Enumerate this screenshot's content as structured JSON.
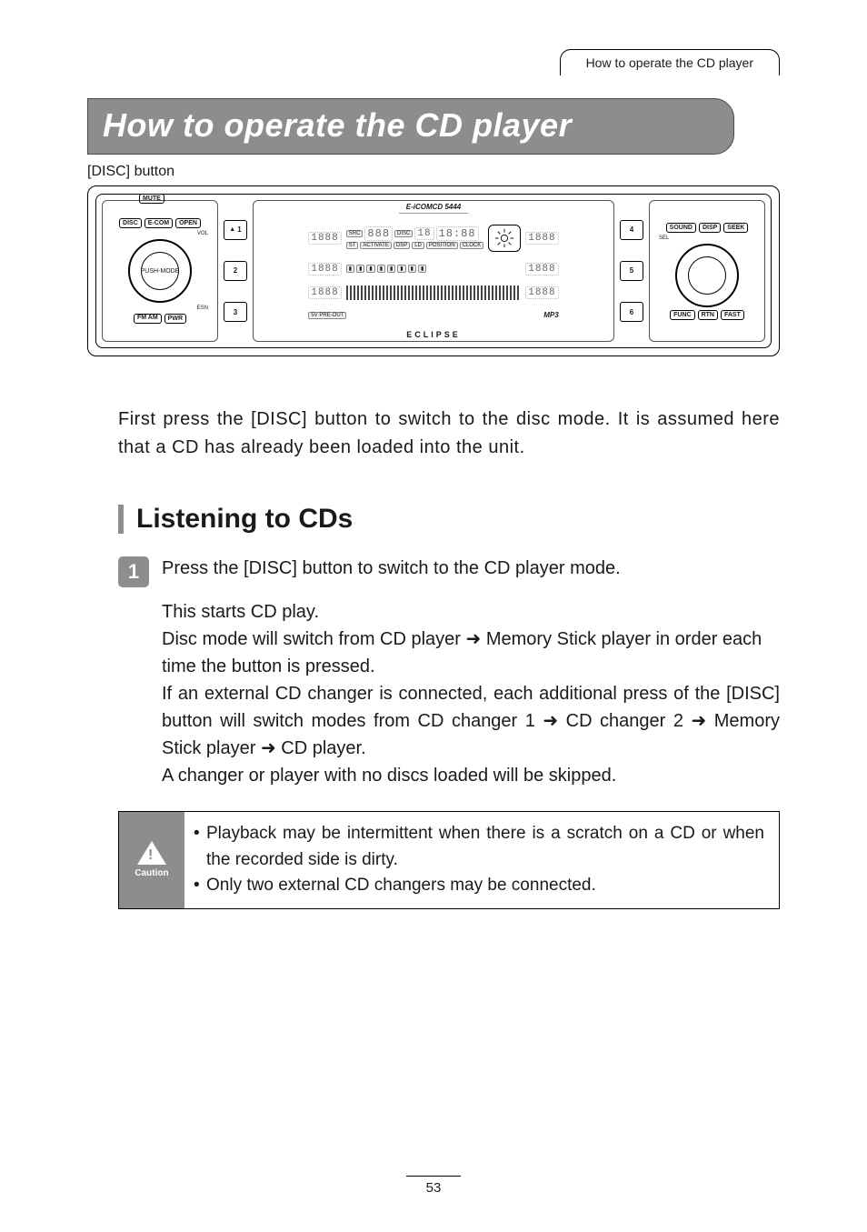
{
  "header_tab": "How to operate the CD player",
  "title": "How to operate the CD player",
  "callout_disc_button": "[DISC] button",
  "panel": {
    "left_buttons": {
      "mute": "MUTE",
      "disc": "DISC",
      "ecom": "E-COM",
      "open": "OPEN",
      "fm_am": "FM\nAM",
      "pwr": "PWR",
      "esn": "ESN",
      "vol": "VOL",
      "push_mode": "PUSH-MODE"
    },
    "preset_left": [
      "1",
      "2",
      "3"
    ],
    "preset_left_eject": "▲",
    "preset_right": [
      "4",
      "5",
      "6"
    ],
    "screen": {
      "brand_left": "E-iCOM",
      "model": "CD 5444",
      "row1_seg_a": "1888",
      "row1_src": "SRC",
      "row1_st": "ST",
      "row1_seg_b": "888",
      "row1_disc": "DISC",
      "row1_seg_c": "18",
      "row1_time": "18:88",
      "row1_seg_d": "1888",
      "row1_tags": [
        "ACTIVATE",
        "DSP",
        "LD",
        "POSITION",
        "CLOCK"
      ],
      "row2_seg_a": "1888",
      "row2_seg_d": "1888",
      "row3_seg_a": "1888",
      "row3_seg_d": "1888",
      "preout": "5V PRE-OUT",
      "mp3": "MP3",
      "brand_center": "ECLIPSE"
    },
    "right_buttons": {
      "sound": "SOUND",
      "disp": "DISP",
      "seek": "SEEK",
      "sel": "SEL",
      "func": "FUNC",
      "rtn": "RTN",
      "fast": "FAST"
    }
  },
  "intro": "First press the [DISC] button to switch to the disc mode.  It is assumed here that a CD has already been loaded into the unit.",
  "section_heading": "Listening to CDs",
  "step1": {
    "num": "1",
    "title": "Press the [DISC] button to switch to the CD player mode.",
    "body_l1": "This starts CD play.",
    "body_l2a": "Disc mode will switch from CD player ",
    "body_l2b": " Memory Stick player in order each time the button is pressed.",
    "body_l3a": "If an external CD changer is connected, each additional press of the [DISC] button will switch modes from CD changer 1 ",
    "body_l3b": " CD changer 2 ",
    "body_l3c": " Memory Stick player ",
    "body_l3d": " CD player.",
    "body_l4": "A changer or player with no discs loaded will be skipped."
  },
  "arrow": "➜",
  "caution": {
    "label": "Caution",
    "items": [
      "Playback may be intermittent when there is a scratch on a CD or when the recorded side is dirty.",
      "Only two external CD changers may be connected."
    ]
  },
  "page_number": "53"
}
